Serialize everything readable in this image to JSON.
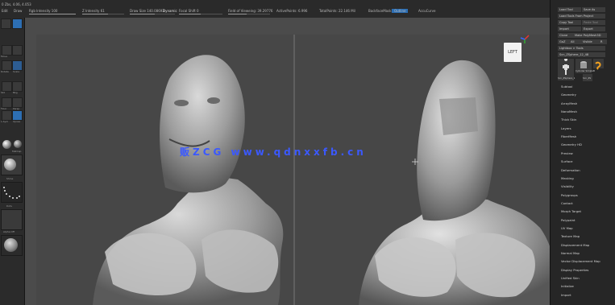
{
  "title_fragment": "0 Zbs, 4.06, 4.053",
  "top_tabs": [
    "Edit",
    "Draw"
  ],
  "top_metrics": [
    {
      "label": "Rgb Intensity 100"
    },
    {
      "label": "Z Intensity 61"
    },
    {
      "label": "Draw Size 140.08693",
      "extra": "Dynamic"
    },
    {
      "label": "Focal Shift 0"
    },
    {
      "label": "Field of Vieweing: 39.29776"
    },
    {
      "label": "ActivePoints: 6.996"
    },
    {
      "label": "TotalPoints: 22.146 Mil"
    },
    {
      "label": "BackfaceMask",
      "button": "Outline"
    },
    {
      "label": "AccuCurve"
    }
  ],
  "left_labels": [
    "Move",
    "Rotate",
    "Scale",
    "Std",
    "Bkg",
    "Floor",
    "Persp",
    "L.Sym",
    "Xpose",
    "MatCap",
    "Dots",
    "Alpha Off"
  ],
  "orientation_label": "LEFT",
  "watermark": "贩ZCG www.qdnxxfb.cn",
  "right_panel": {
    "buttons": [
      [
        "Load Tool",
        "Save As"
      ],
      [
        "Load Tools From Project"
      ],
      [
        "Copy Tool",
        "Paste Tool"
      ],
      [
        "Import",
        "Export"
      ],
      [
        "Clone",
        "Make PolyMesh3D"
      ],
      [
        "GoZ",
        "All",
        "Visible",
        "R"
      ],
      [
        "Lightbox > Tools"
      ],
      [
        "Scn_ZSphere_12_48"
      ]
    ],
    "thumbs": [
      "Scn_ZSphere_1",
      "Cylinder SimpleB",
      "Scn_ZS"
    ],
    "menu": [
      "Subtool",
      "Geometry",
      "ArrayMesh",
      "NanoMesh",
      "Thick Skin",
      "Layers",
      "FiberMesh",
      "Geometry HD",
      "Preview",
      "Surface",
      "Deformation",
      "Masking",
      "Visibility",
      "Polygroups",
      "Contact",
      "Morph Target",
      "Polypaint",
      "UV Map",
      "Texture Map",
      "Displacement Map",
      "Normal Map",
      "Vector Displacement Map",
      "Display Properties",
      "Unified Skin",
      "Initialize",
      "Import"
    ]
  },
  "colors": {
    "accent": "#2d6fb4",
    "watermark": "#3b59ff"
  }
}
